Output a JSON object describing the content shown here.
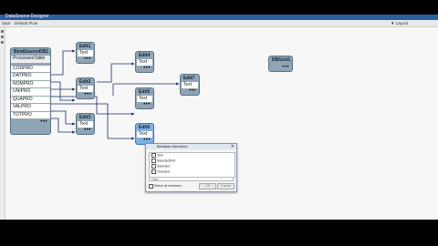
{
  "app": {
    "title": "DataSource Designer",
    "tabs": [
      "Start",
      "Default Flow"
    ],
    "right_status": "▼ Layout"
  },
  "source": {
    "title": "BindSourceDB1",
    "subtitle": "ProcessesTable",
    "fields": [
      "CODPRO",
      "DATPRO",
      "NOMPRO",
      "UNIPRO",
      "QUAPRO",
      "VALPRO",
      "TOTPRO"
    ]
  },
  "nodes": [
    {
      "id": "edit1",
      "title": "Edit1",
      "body": "Text"
    },
    {
      "id": "edit2",
      "title": "Edit2",
      "body": "Text"
    },
    {
      "id": "edit3",
      "title": "Edit3",
      "body": "Text"
    },
    {
      "id": "edit4",
      "title": "Edit4",
      "body": "Text"
    },
    {
      "id": "edit5",
      "title": "Edit5",
      "body": "Text"
    },
    {
      "id": "edit6",
      "title": "Edit6",
      "body": "Text"
    },
    {
      "id": "edit7",
      "title": "Edit7",
      "body": "Text"
    },
    {
      "id": "dbgrid",
      "title": "DBGrid1",
      "body": ""
    }
  ],
  "dialog": {
    "title": "Bindable Members",
    "items": [
      "Text",
      "SelectedText",
      "Selected",
      "Checked"
    ],
    "input": "Filter",
    "footer": "Select all members ..",
    "ok": "OK",
    "cancel": "Cancel"
  }
}
